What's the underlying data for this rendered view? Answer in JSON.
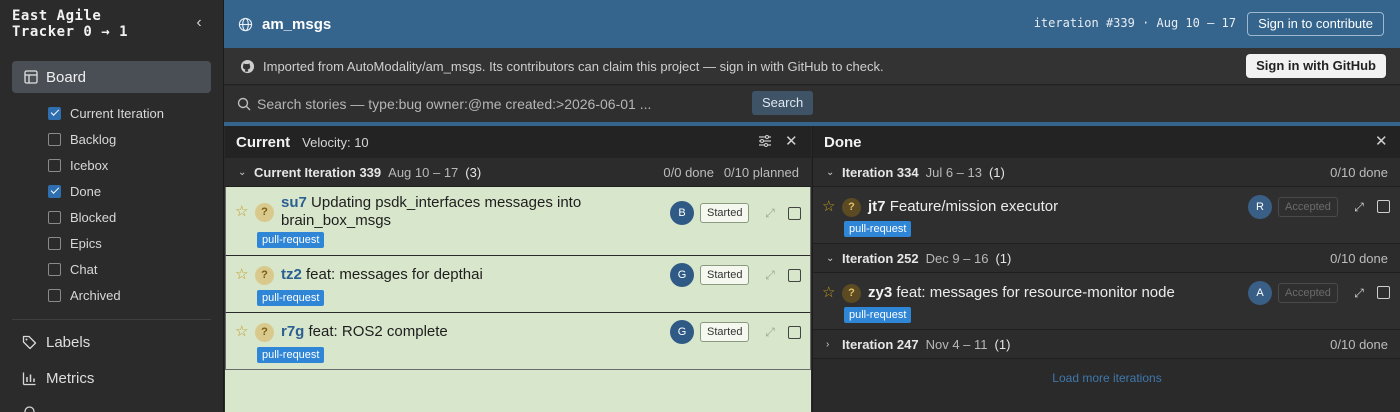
{
  "sidebar": {
    "brand_line1": "East Agile",
    "brand_line2": "Tracker 0 → 1",
    "board_label": "Board",
    "filters": [
      {
        "label": "Current Iteration",
        "checked": true
      },
      {
        "label": "Backlog",
        "checked": false
      },
      {
        "label": "Icebox",
        "checked": false
      },
      {
        "label": "Done",
        "checked": true
      },
      {
        "label": "Blocked",
        "checked": false
      },
      {
        "label": "Epics",
        "checked": false
      },
      {
        "label": "Chat",
        "checked": false
      },
      {
        "label": "Archived",
        "checked": false
      }
    ],
    "nav": [
      {
        "label": "Labels",
        "icon": "tag-icon"
      },
      {
        "label": "Metrics",
        "icon": "bar-chart-icon"
      }
    ]
  },
  "header": {
    "project": "am_msgs",
    "iteration_info": "iteration #339 · Aug 10 – 17",
    "signin_label": "Sign in to contribute"
  },
  "import_bar": {
    "text": "Imported from AutoModality/am_msgs. Its contributors can claim this project — sign in with GitHub to check.",
    "button": "Sign in with GitHub"
  },
  "search": {
    "placeholder": "Search stories — type:bug owner:@me created:>2026-06-01 ...",
    "button": "Search"
  },
  "current": {
    "title": "Current",
    "velocity": "Velocity: 10",
    "iteration": {
      "name": "Current Iteration 339",
      "dates": "Aug 10 – 17",
      "count": "(3)",
      "done": "0/0 done",
      "planned": "0/10 planned"
    },
    "stories": [
      {
        "id": "su7",
        "title": "Updating psdk_interfaces messages into brain_box_msgs",
        "estimate": "?",
        "label": "pull-request",
        "owner": "B",
        "state": "Started"
      },
      {
        "id": "tz2",
        "title": "feat: messages for depthai",
        "estimate": "?",
        "label": "pull-request",
        "owner": "G",
        "state": "Started"
      },
      {
        "id": "r7g",
        "title": "feat: ROS2 complete",
        "estimate": "?",
        "label": "pull-request",
        "owner": "G",
        "state": "Started"
      }
    ]
  },
  "done": {
    "title": "Done",
    "iterations": [
      {
        "name": "Iteration 334",
        "dates": "Jul 6 – 13",
        "count": "(1)",
        "done": "0/10 done",
        "story": {
          "id": "jt7",
          "title": "Feature/mission executor",
          "estimate": "?",
          "label": "pull-request",
          "owner": "R",
          "state": "Accepted"
        }
      },
      {
        "name": "Iteration 252",
        "dates": "Dec 9 – 16",
        "count": "(1)",
        "done": "0/10 done",
        "story": {
          "id": "zy3",
          "title": "feat: messages for resource-monitor node",
          "estimate": "?",
          "label": "pull-request",
          "owner": "A",
          "state": "Accepted"
        }
      },
      {
        "name": "Iteration 247",
        "dates": "Nov 4 – 11",
        "count": "(1)",
        "done": "0/10 done"
      }
    ],
    "load_more": "Load more iterations"
  },
  "colors": {
    "header": "#35648d",
    "current_bg": "#d8e6cc",
    "label": "#2f86d6",
    "avatar": "#2f5a85"
  }
}
